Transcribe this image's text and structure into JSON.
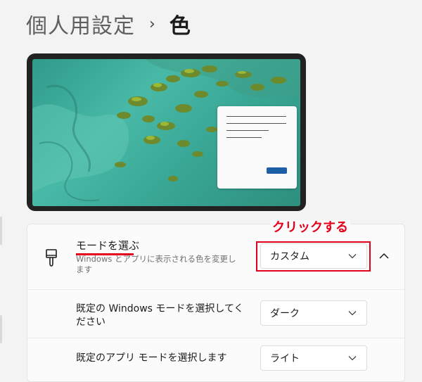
{
  "breadcrumb": {
    "parent": "個人用設定",
    "separator": "›",
    "current": "色"
  },
  "mode_section": {
    "title": "モードを選ぶ",
    "description": "Windows とアプリに表示される色を変更します",
    "selected": "カスタム"
  },
  "annotation": {
    "text": "クリックする",
    "color": "#e3001b"
  },
  "settings": [
    {
      "label": "既定の Windows モードを選択してください",
      "value": "ダーク"
    },
    {
      "label": "既定のアプリ モードを選択します",
      "value": "ライト"
    }
  ],
  "icons": {
    "mode": "paintbrush-icon",
    "collapse": "chevron-up-icon",
    "dropdown": "chevron-down-icon"
  }
}
